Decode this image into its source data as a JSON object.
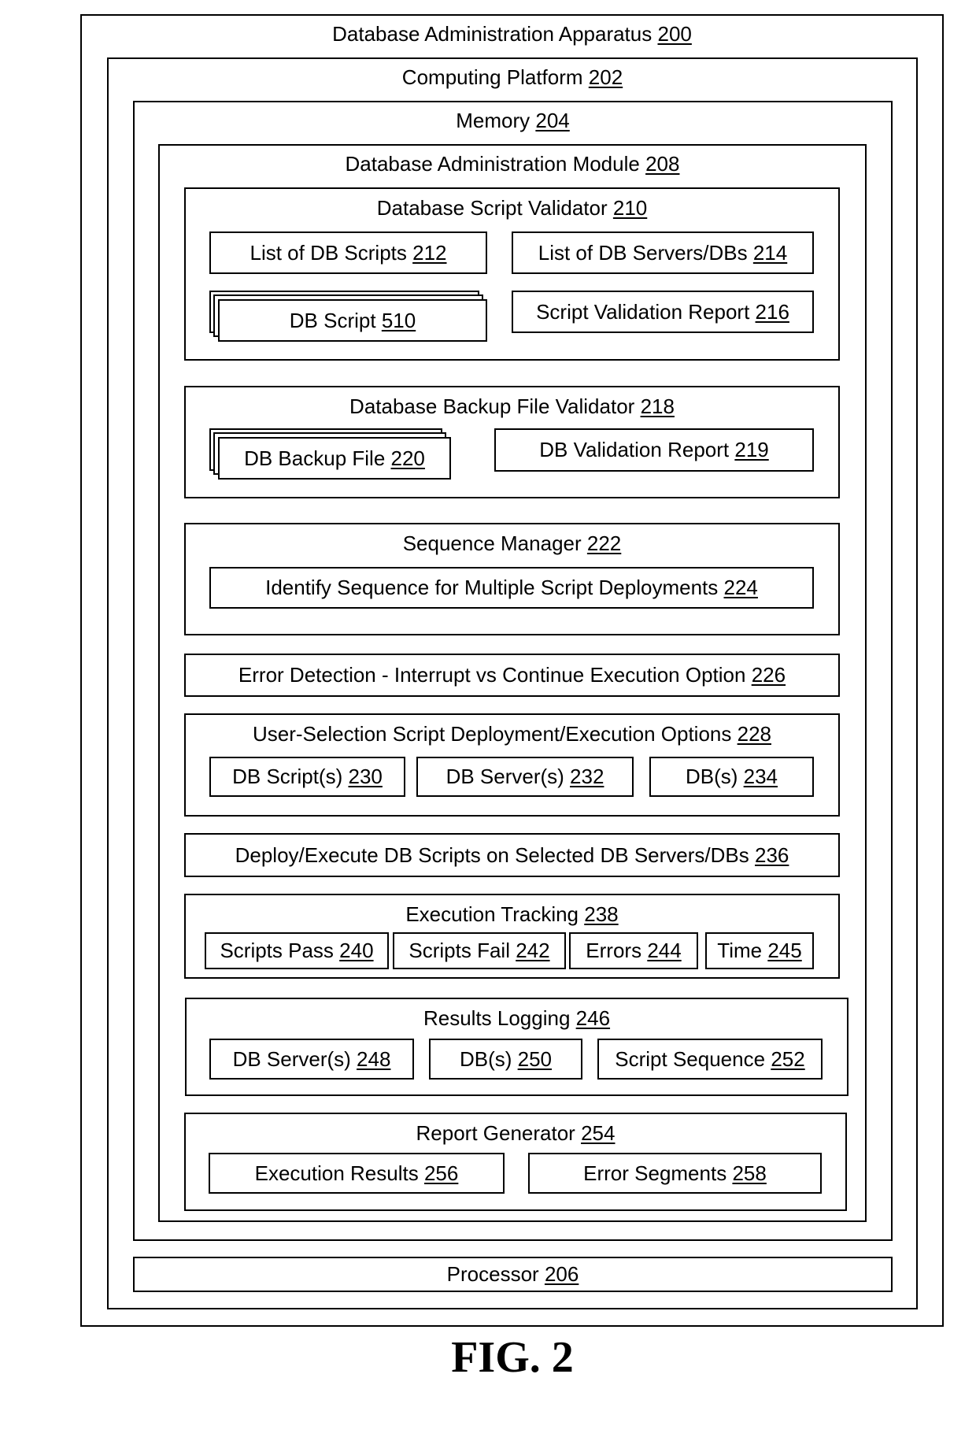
{
  "apparatus": {
    "label": "Database Administration Apparatus",
    "num": "200"
  },
  "platform": {
    "label": "Computing Platform",
    "num": "202"
  },
  "memory": {
    "label": "Memory",
    "num": "204"
  },
  "processor": {
    "label": "Processor",
    "num": "206"
  },
  "module": {
    "label": "Database Administration Module",
    "num": "208"
  },
  "script_validator": {
    "label": "Database Script Validator",
    "num": "210",
    "list_scripts": {
      "label": "List of DB Scripts",
      "num": "212"
    },
    "list_servers": {
      "label": "List of DB Servers/DBs",
      "num": "214"
    },
    "db_script": {
      "label": "DB Script",
      "num": "510"
    },
    "report": {
      "label": "Script Validation Report",
      "num": "216"
    }
  },
  "backup_validator": {
    "label": "Database Backup File Validator",
    "num": "218",
    "backup_file": {
      "label": "DB Backup File",
      "num": "220"
    },
    "report": {
      "label": "DB Validation Report",
      "num": "219"
    }
  },
  "sequence_manager": {
    "label": "Sequence Manager",
    "num": "222",
    "identify": {
      "label": "Identify Sequence for Multiple Script Deployments",
      "num": "224"
    }
  },
  "error_detection": {
    "label": "Error Detection - Interrupt vs Continue Execution Option",
    "num": "226"
  },
  "user_selection": {
    "label": "User-Selection Script Deployment/Execution Options",
    "num": "228",
    "items": [
      {
        "label": "DB Script(s)",
        "num": "230"
      },
      {
        "label": "DB Server(s)",
        "num": "232"
      },
      {
        "label": "DB(s)",
        "num": "234"
      }
    ]
  },
  "deploy": {
    "label": "Deploy/Execute DB Scripts on Selected DB Servers/DBs",
    "num": "236"
  },
  "execution_tracking": {
    "label": "Execution Tracking",
    "num": "238",
    "items": [
      {
        "label": "Scripts Pass",
        "num": "240"
      },
      {
        "label": "Scripts Fail",
        "num": "242"
      },
      {
        "label": "Errors",
        "num": "244"
      },
      {
        "label": "Time",
        "num": "245"
      }
    ]
  },
  "results_logging": {
    "label": "Results Logging",
    "num": "246",
    "items": [
      {
        "label": "DB Server(s)",
        "num": "248"
      },
      {
        "label": "DB(s)",
        "num": "250"
      },
      {
        "label": "Script Sequence",
        "num": "252"
      }
    ]
  },
  "report_generator": {
    "label": "Report Generator",
    "num": "254",
    "items": [
      {
        "label": "Execution Results",
        "num": "256"
      },
      {
        "label": "Error Segments",
        "num": "258"
      }
    ]
  },
  "figure_label": "FIG. 2"
}
